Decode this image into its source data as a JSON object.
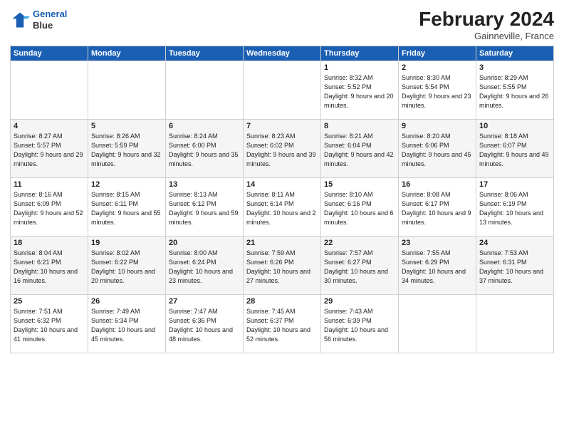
{
  "logo": {
    "line1": "General",
    "line2": "Blue"
  },
  "title": "February 2024",
  "location": "Gainneville, France",
  "days_header": [
    "Sunday",
    "Monday",
    "Tuesday",
    "Wednesday",
    "Thursday",
    "Friday",
    "Saturday"
  ],
  "weeks": [
    [
      {
        "day": "",
        "info": ""
      },
      {
        "day": "",
        "info": ""
      },
      {
        "day": "",
        "info": ""
      },
      {
        "day": "",
        "info": ""
      },
      {
        "day": "1",
        "info": "Sunrise: 8:32 AM\nSunset: 5:52 PM\nDaylight: 9 hours\nand 20 minutes."
      },
      {
        "day": "2",
        "info": "Sunrise: 8:30 AM\nSunset: 5:54 PM\nDaylight: 9 hours\nand 23 minutes."
      },
      {
        "day": "3",
        "info": "Sunrise: 8:29 AM\nSunset: 5:55 PM\nDaylight: 9 hours\nand 26 minutes."
      }
    ],
    [
      {
        "day": "4",
        "info": "Sunrise: 8:27 AM\nSunset: 5:57 PM\nDaylight: 9 hours\nand 29 minutes."
      },
      {
        "day": "5",
        "info": "Sunrise: 8:26 AM\nSunset: 5:59 PM\nDaylight: 9 hours\nand 32 minutes."
      },
      {
        "day": "6",
        "info": "Sunrise: 8:24 AM\nSunset: 6:00 PM\nDaylight: 9 hours\nand 35 minutes."
      },
      {
        "day": "7",
        "info": "Sunrise: 8:23 AM\nSunset: 6:02 PM\nDaylight: 9 hours\nand 39 minutes."
      },
      {
        "day": "8",
        "info": "Sunrise: 8:21 AM\nSunset: 6:04 PM\nDaylight: 9 hours\nand 42 minutes."
      },
      {
        "day": "9",
        "info": "Sunrise: 8:20 AM\nSunset: 6:06 PM\nDaylight: 9 hours\nand 45 minutes."
      },
      {
        "day": "10",
        "info": "Sunrise: 8:18 AM\nSunset: 6:07 PM\nDaylight: 9 hours\nand 49 minutes."
      }
    ],
    [
      {
        "day": "11",
        "info": "Sunrise: 8:16 AM\nSunset: 6:09 PM\nDaylight: 9 hours\nand 52 minutes."
      },
      {
        "day": "12",
        "info": "Sunrise: 8:15 AM\nSunset: 6:11 PM\nDaylight: 9 hours\nand 55 minutes."
      },
      {
        "day": "13",
        "info": "Sunrise: 8:13 AM\nSunset: 6:12 PM\nDaylight: 9 hours\nand 59 minutes."
      },
      {
        "day": "14",
        "info": "Sunrise: 8:11 AM\nSunset: 6:14 PM\nDaylight: 10 hours\nand 2 minutes."
      },
      {
        "day": "15",
        "info": "Sunrise: 8:10 AM\nSunset: 6:16 PM\nDaylight: 10 hours\nand 6 minutes."
      },
      {
        "day": "16",
        "info": "Sunrise: 8:08 AM\nSunset: 6:17 PM\nDaylight: 10 hours\nand 9 minutes."
      },
      {
        "day": "17",
        "info": "Sunrise: 8:06 AM\nSunset: 6:19 PM\nDaylight: 10 hours\nand 13 minutes."
      }
    ],
    [
      {
        "day": "18",
        "info": "Sunrise: 8:04 AM\nSunset: 6:21 PM\nDaylight: 10 hours\nand 16 minutes."
      },
      {
        "day": "19",
        "info": "Sunrise: 8:02 AM\nSunset: 6:22 PM\nDaylight: 10 hours\nand 20 minutes."
      },
      {
        "day": "20",
        "info": "Sunrise: 8:00 AM\nSunset: 6:24 PM\nDaylight: 10 hours\nand 23 minutes."
      },
      {
        "day": "21",
        "info": "Sunrise: 7:59 AM\nSunset: 6:26 PM\nDaylight: 10 hours\nand 27 minutes."
      },
      {
        "day": "22",
        "info": "Sunrise: 7:57 AM\nSunset: 6:27 PM\nDaylight: 10 hours\nand 30 minutes."
      },
      {
        "day": "23",
        "info": "Sunrise: 7:55 AM\nSunset: 6:29 PM\nDaylight: 10 hours\nand 34 minutes."
      },
      {
        "day": "24",
        "info": "Sunrise: 7:53 AM\nSunset: 6:31 PM\nDaylight: 10 hours\nand 37 minutes."
      }
    ],
    [
      {
        "day": "25",
        "info": "Sunrise: 7:51 AM\nSunset: 6:32 PM\nDaylight: 10 hours\nand 41 minutes."
      },
      {
        "day": "26",
        "info": "Sunrise: 7:49 AM\nSunset: 6:34 PM\nDaylight: 10 hours\nand 45 minutes."
      },
      {
        "day": "27",
        "info": "Sunrise: 7:47 AM\nSunset: 6:36 PM\nDaylight: 10 hours\nand 48 minutes."
      },
      {
        "day": "28",
        "info": "Sunrise: 7:45 AM\nSunset: 6:37 PM\nDaylight: 10 hours\nand 52 minutes."
      },
      {
        "day": "29",
        "info": "Sunrise: 7:43 AM\nSunset: 6:39 PM\nDaylight: 10 hours\nand 56 minutes."
      },
      {
        "day": "",
        "info": ""
      },
      {
        "day": "",
        "info": ""
      }
    ]
  ]
}
